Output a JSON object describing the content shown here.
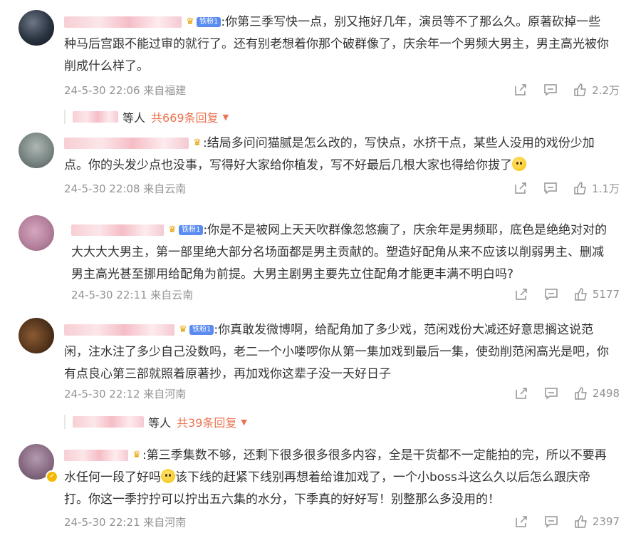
{
  "comments": [
    {
      "text": ":你第三季写快一点，别又拖好几年，演员等不了那么久。原著砍掉一些种马后宫跟不能过审的就行了。还有别老想着你那个破群像了，庆余年一个男频大男主，男主高光被你削成什么样了。",
      "badge": "铁粉1",
      "time": "24-5-30 22:06 来自福建",
      "likes": "2.2万",
      "replies": {
        "who": "等人",
        "more": "共669条回复"
      }
    },
    {
      "text": ":结局多问问猫腻是怎么改的，写快点，水挤干点，某些人没用的戏份少加点。你的头发少点也没事，写得好大家给你植发，写不好最后几根大家也得给你拔了",
      "badge": "",
      "time": "24-5-30 22:08 来自云南",
      "likes": "1.1万"
    },
    {
      "text": ":你是不是被网上天天吹群像忽悠瘸了，庆余年是男频耶，底色是绝绝对对的大大大大男主，第一部里绝大部分名场面都是男主贡献的。塑造好配角从来不应该以削弱男主、删减男主高光甚至挪用给配角为前提。大男主剧男主要先立住配角才能更丰满不明白吗?",
      "badge": "铁粉1",
      "time": "24-5-30 22:11 来自云南",
      "likes": "5177"
    },
    {
      "text": ":你真敢发微博啊，给配角加了多少戏，范闲戏份大减还好意思搁这说范闲，注水注了多少自己没数吗，老二一个小喽啰你从第一集加戏到最后一集，使劲削范闲高光是吧，你有点良心第三部就照着原著抄，再加戏你这辈子没一天好日子",
      "badge": "铁粉1",
      "time": "24-5-30 22:12 来自河南",
      "likes": "2498",
      "replies": {
        "who": "等人",
        "more": "共39条回复"
      }
    },
    {
      "text_a": ":第三季集数不够，还剩下很多很多很多内容，全是干货都不一定能拍的完，所以不要再水任何一段了好吗",
      "text_b": "该下线的赶紧下线别再想着给谁加戏了，一个小boss斗这么久以后怎么跟庆帝打。你这一季拧拧可以拧出五六集的水分，下季真的好好写！别整那么多没用的！",
      "badge": "",
      "time": "24-5-30 22:21 来自河南",
      "likes": "2397"
    }
  ],
  "icons": {
    "share": "share-icon",
    "comment": "comment-icon",
    "like": "like-icon",
    "vip": "vip-check-icon"
  },
  "colors": {
    "reply_link": "#eb7350",
    "fan_badge": "#5a8bf0",
    "meta": "#939393"
  }
}
